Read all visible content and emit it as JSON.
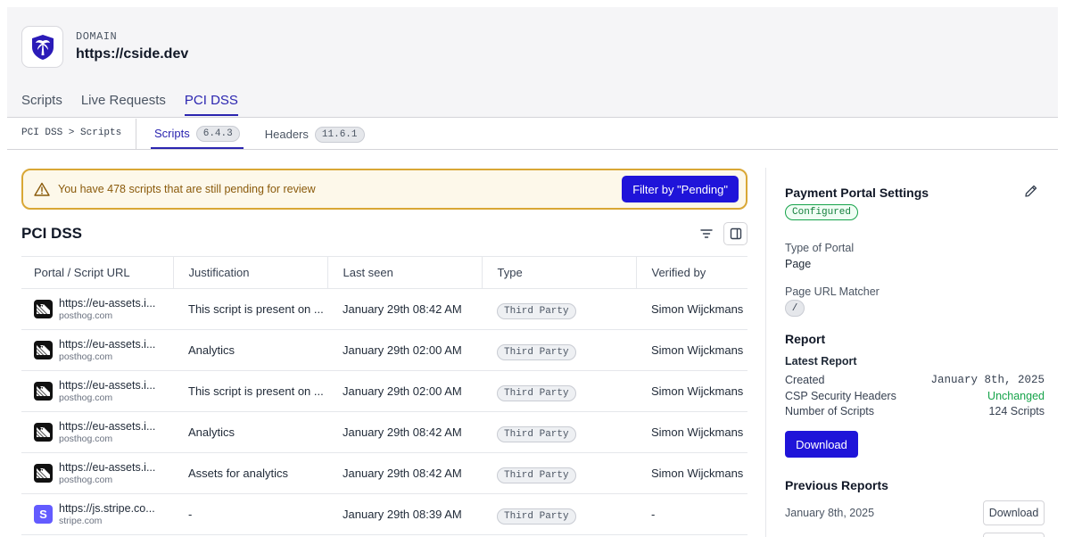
{
  "header": {
    "domain_label": "DOMAIN",
    "domain_value": "https://cside.dev"
  },
  "main_tabs": [
    {
      "label": "Scripts",
      "active": false
    },
    {
      "label": "Live Requests",
      "active": false
    },
    {
      "label": "PCI DSS",
      "active": true
    }
  ],
  "breadcrumb": "PCI DSS > Scripts",
  "sub_tabs": [
    {
      "label": "Scripts",
      "badge": "6.4.3",
      "active": true
    },
    {
      "label": "Headers",
      "badge": "11.6.1",
      "active": false
    }
  ],
  "alert": {
    "message": "You have 478 scripts that are still pending for review",
    "button": "Filter by \"Pending\""
  },
  "section_title": "PCI DSS",
  "table": {
    "columns": [
      "Portal / Script URL",
      "Justification",
      "Last seen",
      "Type",
      "Verified by"
    ],
    "rows": [
      {
        "url": "https://eu-assets.i...",
        "host": "posthog.com",
        "icon": "posthog-icon",
        "justification": "This script is present on ...",
        "last_seen": "January 29th 08:42 AM",
        "type": "Third Party",
        "verified_by": "Simon Wijckmans"
      },
      {
        "url": "https://eu-assets.i...",
        "host": "posthog.com",
        "icon": "posthog-icon",
        "justification": "Analytics",
        "last_seen": "January 29th 02:00 AM",
        "type": "Third Party",
        "verified_by": "Simon Wijckmans"
      },
      {
        "url": "https://eu-assets.i...",
        "host": "posthog.com",
        "icon": "posthog-icon",
        "justification": "This script is present on ...",
        "last_seen": "January 29th 02:00 AM",
        "type": "Third Party",
        "verified_by": "Simon Wijckmans"
      },
      {
        "url": "https://eu-assets.i...",
        "host": "posthog.com",
        "icon": "posthog-icon",
        "justification": "Analytics",
        "last_seen": "January 29th 08:42 AM",
        "type": "Third Party",
        "verified_by": "Simon Wijckmans"
      },
      {
        "url": "https://eu-assets.i...",
        "host": "posthog.com",
        "icon": "posthog-icon",
        "justification": "Assets for analytics",
        "last_seen": "January 29th 08:42 AM",
        "type": "Third Party",
        "verified_by": "Simon Wijckmans"
      },
      {
        "url": "https://js.stripe.co...",
        "host": "stripe.com",
        "icon": "stripe-icon",
        "icon_letter": "S",
        "justification": "-",
        "last_seen": "January 29th 08:39 AM",
        "type": "Third Party",
        "verified_by": "-"
      }
    ]
  },
  "sidebar": {
    "title": "Payment Portal Settings",
    "status": "Configured",
    "portal_type_label": "Type of Portal",
    "portal_type_value": "Page",
    "url_matcher_label": "Page URL Matcher",
    "url_matcher_value": "/",
    "report_title": "Report",
    "latest_title": "Latest Report",
    "created_label": "Created",
    "created_value": "January 8th, 2025",
    "csp_label": "CSP Security Headers",
    "csp_value": "Unchanged",
    "scripts_label": "Number of Scripts",
    "scripts_value": "124 Scripts",
    "download_label": "Download",
    "previous_title": "Previous Reports",
    "previous": [
      {
        "date": "January 8th, 2025",
        "button": "Download"
      }
    ]
  },
  "colors": {
    "accent": "#1f14d9",
    "tab_active": "#2b25b0",
    "alert_border": "#d9a735",
    "success": "#16a34a"
  }
}
